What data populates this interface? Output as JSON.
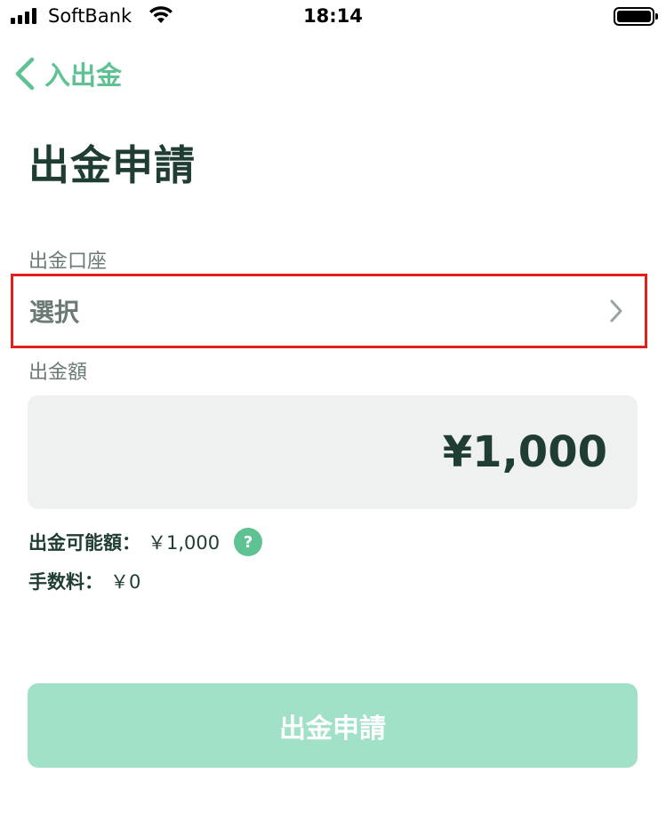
{
  "status_bar": {
    "carrier": "SoftBank",
    "time": "18:14"
  },
  "nav": {
    "back_label": "入出金"
  },
  "page": {
    "title": "出金申請"
  },
  "account": {
    "label": "出金口座",
    "value": "選択"
  },
  "amount": {
    "label": "出金額",
    "value": "¥1,000"
  },
  "available": {
    "label": "出金可能額：",
    "value": "￥1,000",
    "help": "?"
  },
  "fee": {
    "label": "手数料：",
    "value": "￥0"
  },
  "submit": {
    "label": "出金申請"
  },
  "colors": {
    "accent": "#5ec292",
    "submit_disabled": "#a0e1c8",
    "highlight_border": "#e0201f",
    "text_dark": "#1f3d33",
    "text_muted": "#6b7a74",
    "input_bg": "#eff1f0"
  }
}
